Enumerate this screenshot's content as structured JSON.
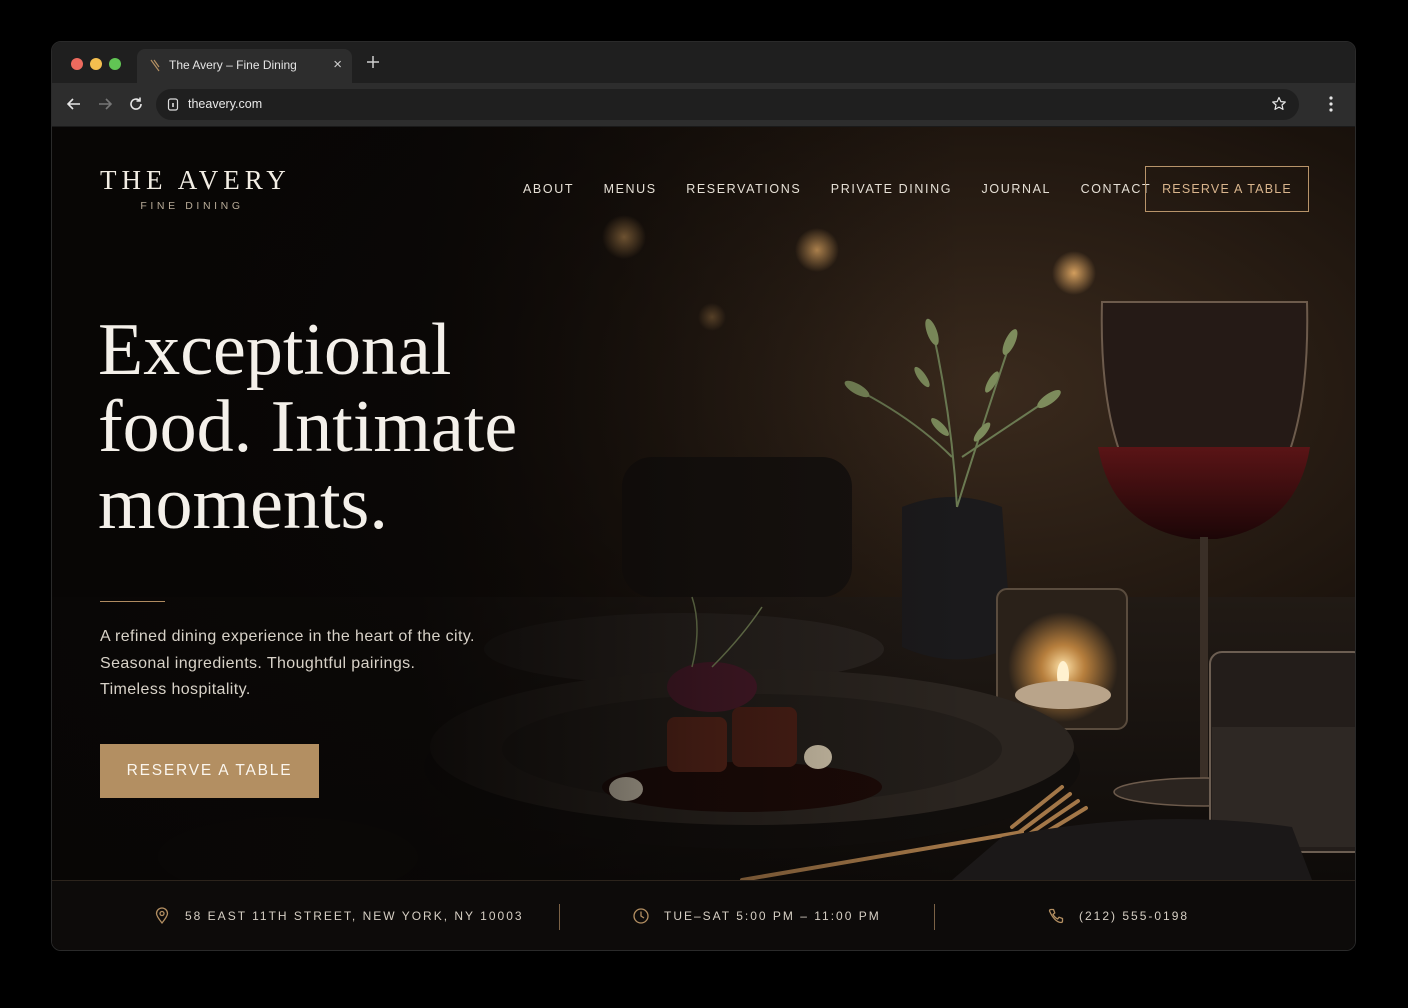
{
  "browser": {
    "tab_title": "The Avery – Fine Dining",
    "tab_close": "×",
    "url": "theavery.com"
  },
  "site": {
    "logo_name": "THE AVERY",
    "logo_sub": "FINE DINING",
    "nav": [
      "ABOUT",
      "MENUS",
      "RESERVATIONS",
      "PRIVATE DINING",
      "JOURNAL",
      "CONTACT"
    ],
    "header_cta": "RESERVE A TABLE"
  },
  "hero": {
    "headline_lines": [
      "Exceptional",
      "food. Intimate",
      "moments."
    ],
    "subtext_lines": [
      "A refined dining experience in the heart of the city.",
      "Seasonal ingredients. Thoughtful pairings.",
      "Timeless hospitality."
    ],
    "cta": "RESERVE A TABLE"
  },
  "info": {
    "address": "58 EAST 11TH STREET, NEW YORK, NY 10003",
    "hours": "TUE–SAT 5:00 PM – 11:00 PM",
    "phone": "(212) 555-0198"
  },
  "colors": {
    "accent_gold": "#b38f62",
    "outline_gold": "#b8946a",
    "background": "#0a0807"
  }
}
